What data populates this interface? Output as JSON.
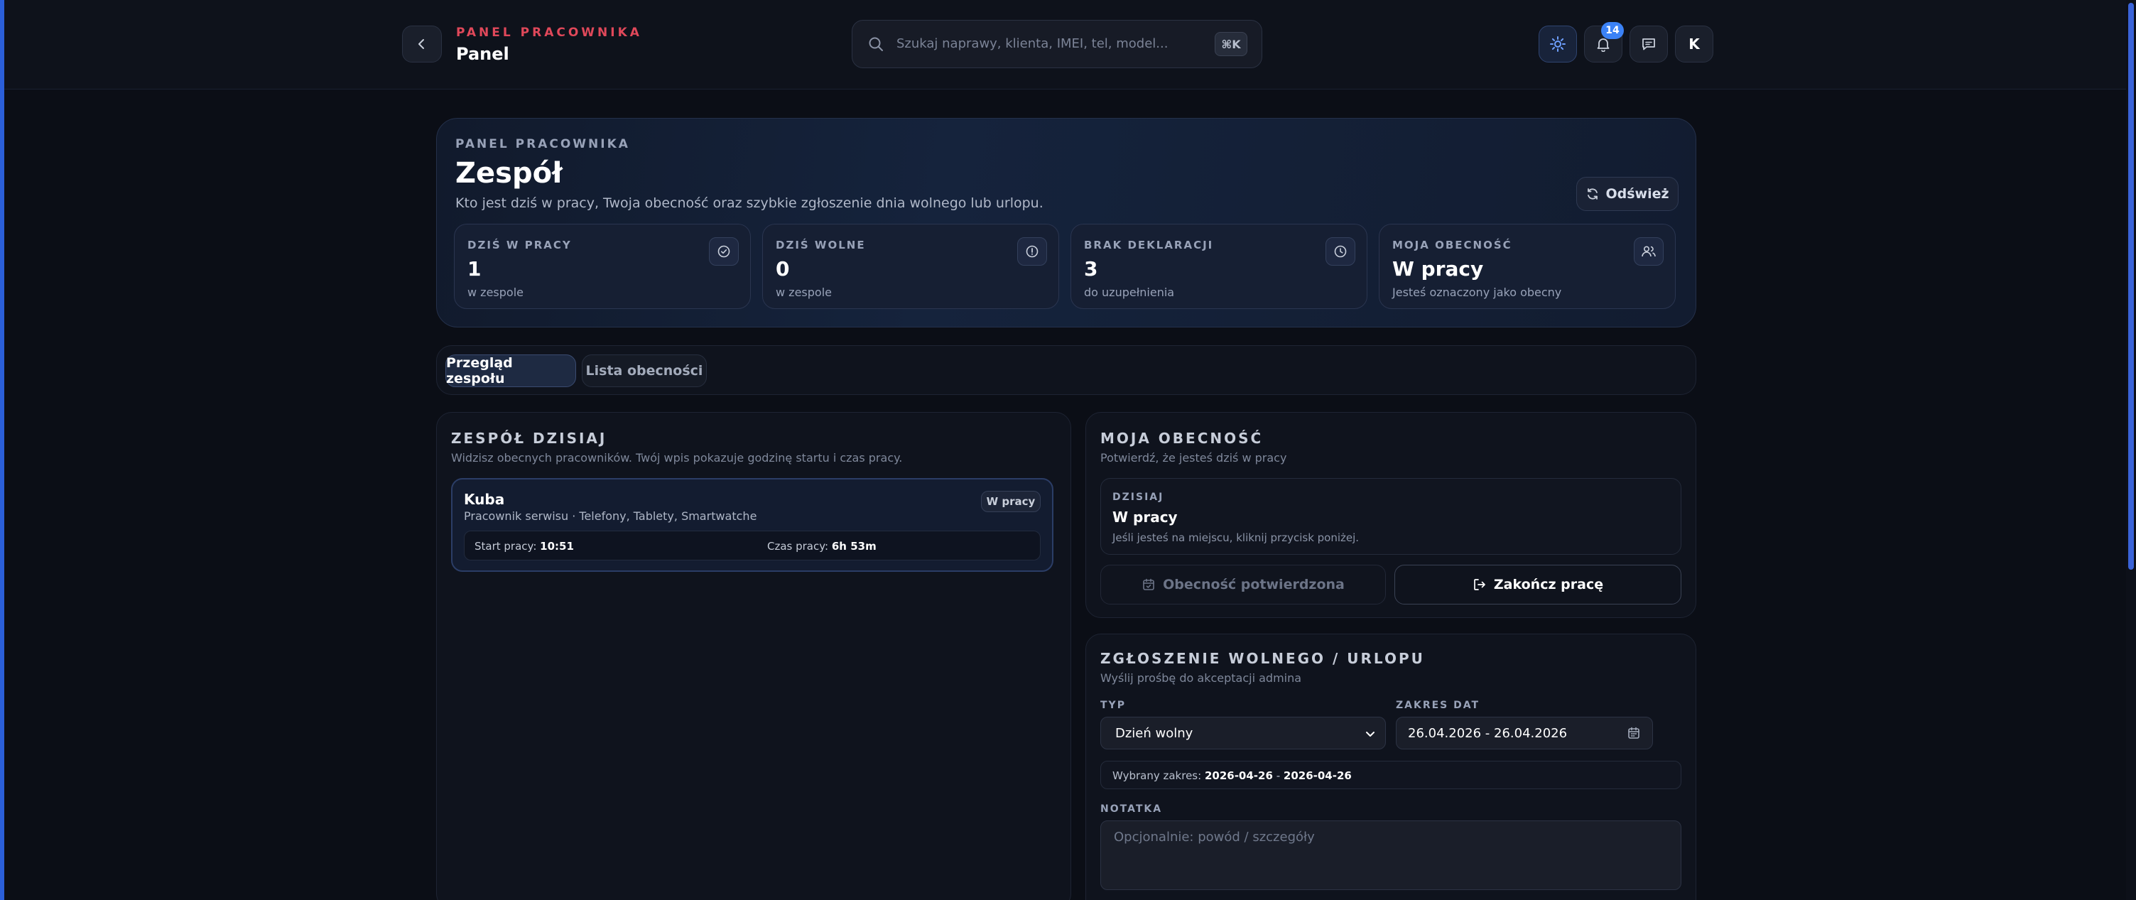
{
  "header": {
    "kicker": "PANEL PRACOWNIKA",
    "title": "Panel",
    "search_placeholder": "Szukaj naprawy, klienta, IMEI, tel, model...",
    "search_shortcut": "⌘K",
    "notifications_count": "14",
    "avatar_initial": "K"
  },
  "hero": {
    "kicker": "PANEL PRACOWNIKA",
    "title": "Zespół",
    "subtitle": "Kto jest dziś w pracy, Twoja obecność oraz szybkie zgłoszenie dnia wolnego lub urlopu.",
    "refresh_label": "Odśwież",
    "stats": [
      {
        "label": "DZIŚ W PRACY",
        "value": "1",
        "sub": "w zespole",
        "icon": "check-circle-icon"
      },
      {
        "label": "DZIŚ WOLNE",
        "value": "0",
        "sub": "w zespole",
        "icon": "info-circle-icon"
      },
      {
        "label": "BRAK DEKLARACJI",
        "value": "3",
        "sub": "do uzupełnienia",
        "icon": "clock-icon"
      },
      {
        "label": "MOJA OBECNOŚĆ",
        "value": "W pracy",
        "sub": "Jesteś oznaczony jako obecny",
        "icon": "users-icon"
      }
    ]
  },
  "tabs": [
    {
      "label": "Przegląd zespołu",
      "active": true
    },
    {
      "label": "Lista obecności",
      "active": false
    }
  ],
  "team": {
    "title": "ZESPÓŁ DZISIAJ",
    "subtitle": "Widzisz obecnych pracowników. Twój wpis pokazuje godzinę startu i czas pracy.",
    "members": [
      {
        "name": "Kuba",
        "role": "Pracownik serwisu · Telefony, Tablety, Smartwatche",
        "status": "W pracy",
        "start_label": "Start pracy:",
        "start_value": "10:51",
        "work_label": "Czas pracy:",
        "work_value": "6h 53m"
      }
    ]
  },
  "presence": {
    "title": "MOJA OBECNOŚĆ",
    "subtitle": "Potwierdź, że jesteś dziś w pracy",
    "today_kicker": "DZISIAJ",
    "today_value": "W pracy",
    "today_hint": "Jeśli jesteś na miejscu, kliknij przycisk poniżej.",
    "confirmed_label": "Obecność potwierdzona",
    "finish_label": "Zakończ pracę"
  },
  "leave": {
    "title": "ZGŁOSZENIE WOLNEGO / URLOPU",
    "subtitle": "Wyślij prośbę do akceptacji admina",
    "type_label": "TYP",
    "type_value": "Dzień wolny",
    "range_label": "ZAKRES DAT",
    "range_value": "26.04.2026 - 26.04.2026",
    "selected_prefix": "Wybrany zakres:",
    "selected_from": "2026-04-26",
    "selected_sep": "-",
    "selected_to": "2026-04-26",
    "note_label": "NOTATKA",
    "note_placeholder": "Opcjonalnie: powód / szczegóły"
  }
}
